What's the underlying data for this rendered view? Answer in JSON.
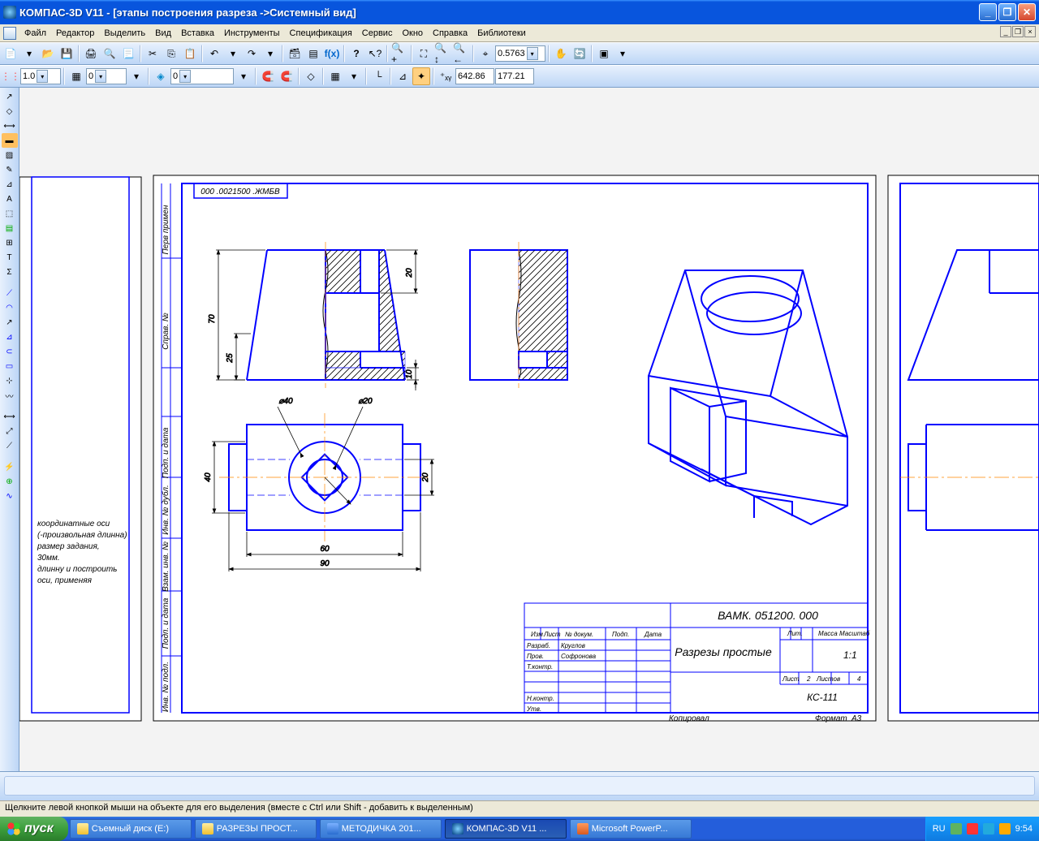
{
  "title": "КОМПАС-3D V11 - [этапы построения разреза ->Системный вид]",
  "menu": [
    "Файл",
    "Редактор",
    "Выделить",
    "Вид",
    "Вставка",
    "Инструменты",
    "Спецификация",
    "Сервис",
    "Окно",
    "Справка",
    "Библиотеки"
  ],
  "toolbar2": {
    "zoom": "0.5763"
  },
  "toolbar3": {
    "scale": "1.0",
    "step": "0",
    "layer": "0",
    "x": "642.86",
    "y": "177.21"
  },
  "drawing": {
    "stamp_num": "000 .0021500 .ЖМБВ",
    "side_labels": [
      "Перв примен",
      "Справ. №",
      "Подп. и дата",
      "Инв. № дубл.",
      "Взам. инв. №",
      "Подп. и дата",
      "Инв. № подл."
    ],
    "notes": [
      "координатные оси",
      "(-произвольная длинна)",
      "размер задания,",
      "30мм.",
      "длинну и построить",
      "оси, применяя"
    ],
    "dims": {
      "h70": "70",
      "h25": "25",
      "h20": "20",
      "h10": "10",
      "w60": "60",
      "w90": "90",
      "w40": "40",
      "w20": "20",
      "d40": "⌀40",
      "d20": "⌀20"
    },
    "titleblock": {
      "code": "ВАМК. 051200. 000",
      "name": "Разрезы простые",
      "rows": [
        "Изм",
        "Лист",
        "№ докум.",
        "Подп.",
        "Дата"
      ],
      "roles": [
        "Разраб.",
        "Пров.",
        "Т.контр.",
        "",
        "Н.контр.",
        "Утв."
      ],
      "surname1": "Круглов",
      "surname2": "Софронова",
      "lit": "Лит.",
      "massa": "Масса",
      "masht": "Масштаб",
      "scale": "1:1",
      "list": "Лист",
      "list_n": "2",
      "listov": "Листов",
      "listov_n": "4",
      "group": "КС-111",
      "copy": "Копировал",
      "format": "Формат",
      "fmt": "А3"
    }
  },
  "status": "Щелкните левой кнопкой мыши на объекте для его выделения (вместе с Ctrl или Shift - добавить к выделенным)",
  "taskbar": {
    "start": "пуск",
    "items": [
      "Съемный диск (E:)",
      "РАЗРЕЗЫ ПРОСТ...",
      "МЕТОДИЧКА 201...",
      "КОМПАС-3D V11 ...",
      "Microsoft PowerP..."
    ],
    "lang": "RU",
    "time": "9:54"
  }
}
